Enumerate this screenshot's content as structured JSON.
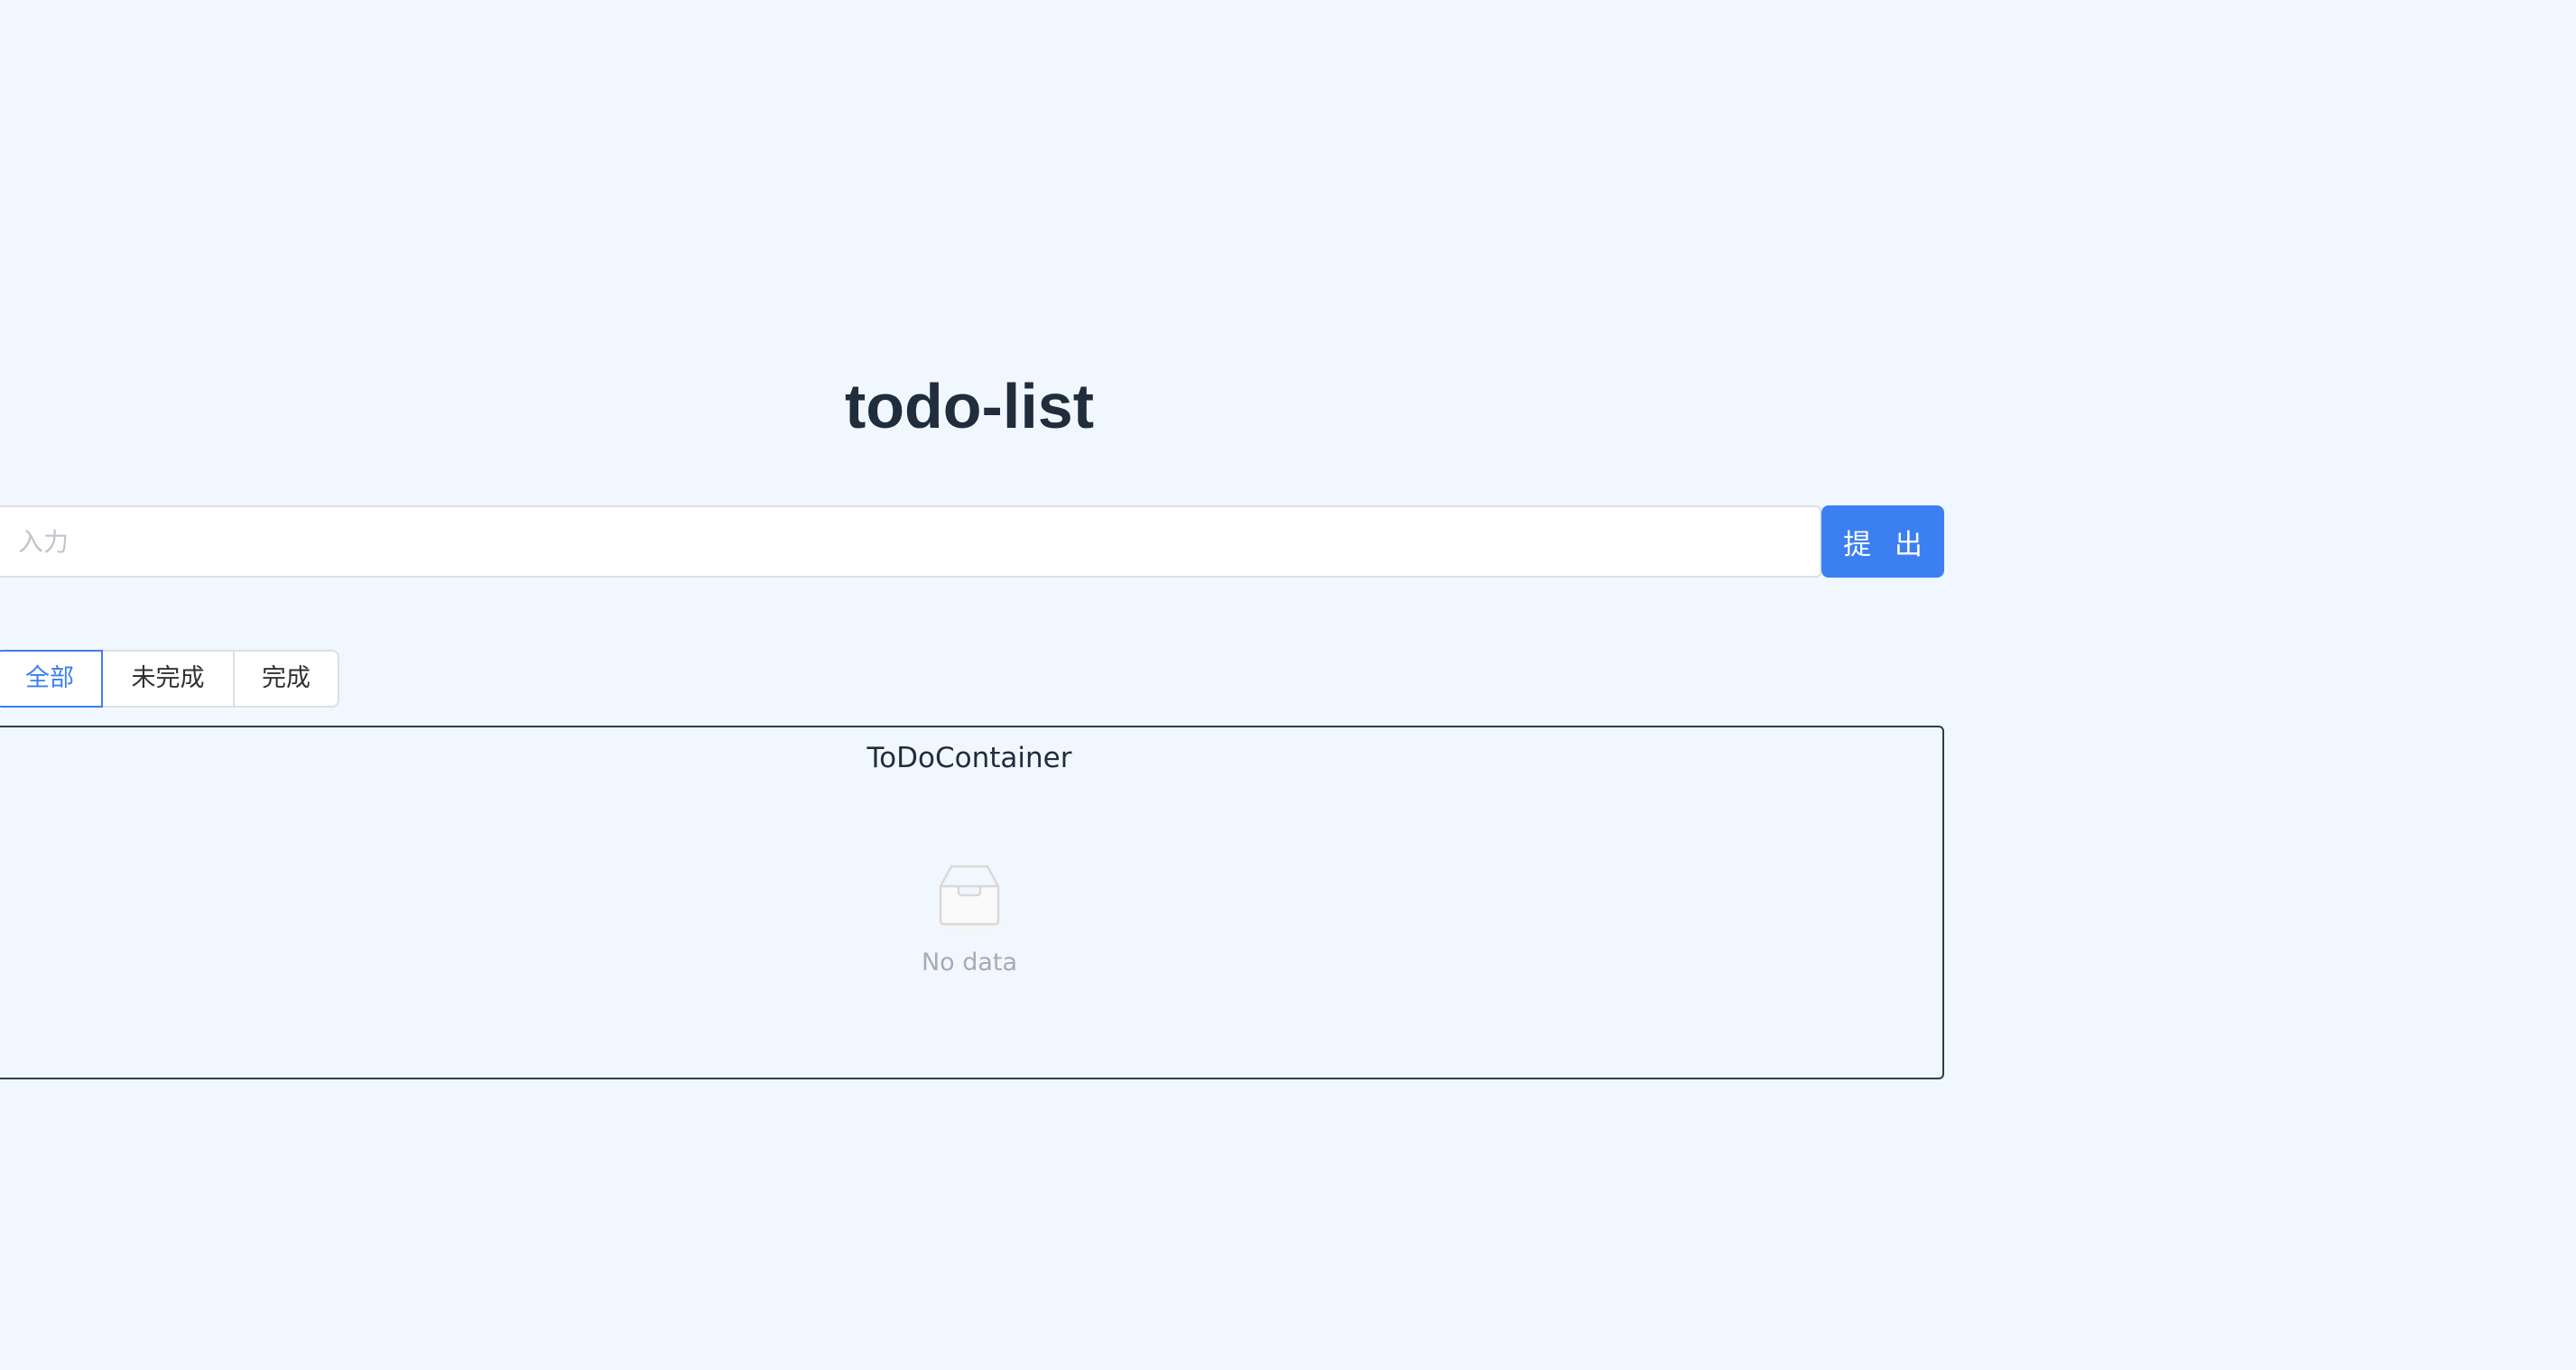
{
  "header": {
    "title": "todo-list"
  },
  "form": {
    "input_value": "",
    "input_placeholder": "入力",
    "submit_label": "提 出"
  },
  "filters": {
    "items": [
      {
        "label": "全部",
        "active": true
      },
      {
        "label": "未完成",
        "active": false
      },
      {
        "label": "完成",
        "active": false
      }
    ]
  },
  "container": {
    "title": "ToDoContainer",
    "empty_text": "No data",
    "empty_icon": "inbox-icon"
  },
  "colors": {
    "background": "#f1f7fe",
    "primary": "#3b7ff3",
    "text": "#1f2d3d",
    "muted": "#a8abb2",
    "border": "#dcdfe6"
  }
}
